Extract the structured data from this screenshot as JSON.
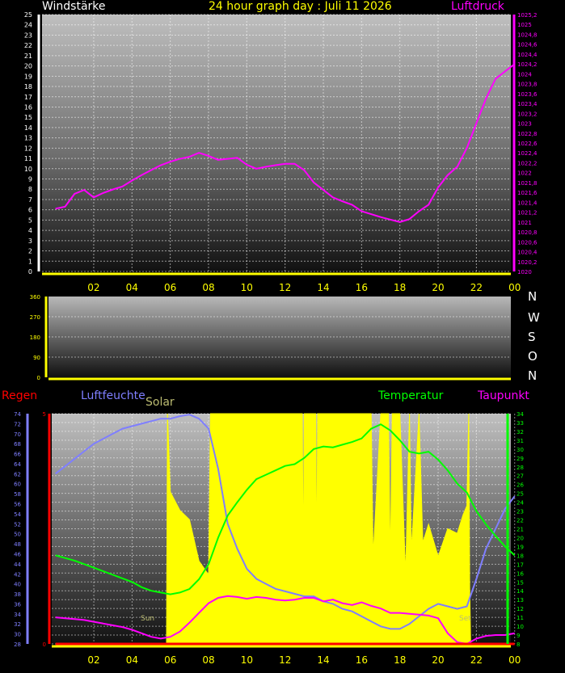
{
  "header": {
    "left_title": "Windstärke",
    "center_title": "24 hour graph day : Juli 11 2026",
    "right_title": "Luftdruck"
  },
  "colors": {
    "wind_axis": "#ffffff",
    "pressure": "#ff00ff",
    "time_axis": "#ffff00",
    "humidity": "#7f7fff",
    "temperature": "#00ff00",
    "dewpoint": "#ff00ff",
    "solar": "#ffff00",
    "rain": "#ff0000"
  },
  "compass": [
    "N",
    "W",
    "S",
    "O",
    "N"
  ],
  "legend2": {
    "rain": "Regen",
    "humidity": "Luftfeuchte",
    "solar": "Solar",
    "temperature": "Temperatur",
    "dewpoint": "Taupunkt"
  },
  "annotations": {
    "sunrise": "Sun",
    "sunset": "Set"
  },
  "chart_data": [
    {
      "type": "line",
      "title": "24 hour graph day : Juli 11 2026",
      "x_tick_labels": [
        "02",
        "04",
        "06",
        "08",
        "10",
        "12",
        "14",
        "16",
        "18",
        "20",
        "22",
        "00"
      ],
      "left_axis": {
        "label": "Windstärke",
        "range": [
          0,
          25
        ],
        "ticks": [
          0,
          1,
          2,
          3,
          4,
          5,
          6,
          7,
          8,
          9,
          10,
          11,
          12,
          13,
          14,
          15,
          16,
          17,
          18,
          19,
          20,
          21,
          22,
          23,
          24,
          25
        ]
      },
      "right_axis": {
        "label": "Luftdruck",
        "range": [
          1020,
          1025.2
        ],
        "ticks": [
          "1020",
          "1020,2",
          "1020,4",
          "1020,6",
          "1020,8",
          "1021",
          "1021,2",
          "1021,4",
          "1021,6",
          "1021,8",
          "1022",
          "1022,2",
          "1022,4",
          "1022,6",
          "1022,8",
          "1023",
          "1023,2",
          "1023,4",
          "1023,6",
          "1023,8",
          "1024",
          "1024,2",
          "1024,4",
          "1024,6",
          "1024,8",
          "1025",
          "1025,2"
        ]
      },
      "grid": true,
      "series": [
        {
          "name": "Luftdruck",
          "axis": "right",
          "x": [
            0.0,
            0.5,
            1.0,
            1.5,
            2.0,
            2.5,
            3.0,
            3.5,
            4.0,
            4.5,
            5.0,
            5.5,
            6.0,
            6.5,
            7.0,
            7.5,
            8.0,
            8.5,
            9.0,
            9.5,
            10.0,
            10.5,
            11.0,
            11.5,
            12.0,
            12.5,
            13.0,
            13.5,
            14.0,
            14.5,
            15.0,
            15.5,
            16.0,
            16.5,
            17.0,
            17.5,
            18.0,
            18.5,
            19.0,
            19.5,
            20.0,
            20.5,
            21.0,
            21.5,
            22.0,
            22.5,
            23.0,
            23.5,
            24.0
          ],
          "y": [
            1021.27,
            1021.31,
            1021.57,
            1021.65,
            1021.5,
            1021.59,
            1021.66,
            1021.72,
            1021.84,
            1021.95,
            1022.05,
            1022.15,
            1022.22,
            1022.28,
            1022.32,
            1022.4,
            1022.34,
            1022.26,
            1022.28,
            1022.3,
            1022.16,
            1022.08,
            1022.12,
            1022.15,
            1022.18,
            1022.18,
            1022.05,
            1021.8,
            1021.65,
            1021.5,
            1021.42,
            1021.35,
            1021.22,
            1021.16,
            1021.1,
            1021.05,
            1021.0,
            1021.06,
            1021.22,
            1021.35,
            1021.7,
            1021.95,
            1022.12,
            1022.5,
            1023.0,
            1023.5,
            1023.9,
            1024.05,
            1024.2
          ]
        }
      ]
    },
    {
      "type": "area",
      "left_axis": {
        "range": [
          0,
          360
        ],
        "ticks": [
          0,
          90,
          180,
          270,
          360
        ]
      },
      "compass_labels": [
        "N",
        "W",
        "S",
        "O",
        "N"
      ],
      "series": []
    },
    {
      "type": "line",
      "x_tick_labels": [
        "02",
        "04",
        "06",
        "08",
        "10",
        "12",
        "14",
        "16",
        "18",
        "20",
        "22",
        "00"
      ],
      "humidity_axis": {
        "label": "Luftfeuchte",
        "range": [
          28,
          74
        ],
        "ticks": [
          28,
          30,
          32,
          34,
          36,
          38,
          40,
          42,
          44,
          46,
          48,
          50,
          52,
          54,
          56,
          58,
          60,
          62,
          64,
          66,
          68,
          70,
          72,
          74
        ]
      },
      "rain_axis": {
        "label": "Regen",
        "range": [
          0,
          5
        ],
        "ticks": [
          0,
          5
        ]
      },
      "temperature_axis": {
        "label": "Temperatur",
        "range": [
          8,
          34
        ],
        "ticks": [
          8,
          9,
          10,
          11,
          12,
          13,
          14,
          15,
          16,
          17,
          18,
          19,
          20,
          21,
          22,
          23,
          24,
          25,
          26,
          27,
          28,
          29,
          30,
          31,
          32,
          33,
          34
        ]
      },
      "grid": true,
      "series": [
        {
          "name": "Luftfeuchte",
          "axis": "humidity",
          "x": [
            0.0,
            0.5,
            1.0,
            1.5,
            2.0,
            2.5,
            3.0,
            3.5,
            4.0,
            4.5,
            5.0,
            5.5,
            6.0,
            6.5,
            7.0,
            7.5,
            8.0,
            8.5,
            9.0,
            9.5,
            10.0,
            10.5,
            11.0,
            11.5,
            12.0,
            12.5,
            13.0,
            13.5,
            14.0,
            14.5,
            15.0,
            15.5,
            16.0,
            16.5,
            17.0,
            17.5,
            18.0,
            18.5,
            19.0,
            19.5,
            20.0,
            20.5,
            21.0,
            21.5,
            22.0,
            22.5,
            23.0,
            23.5,
            24.0
          ],
          "y": [
            62.0,
            63.5,
            65.0,
            66.5,
            68.0,
            69.0,
            70.0,
            71.0,
            71.5,
            72.0,
            72.5,
            73.0,
            73.0,
            73.5,
            73.8,
            73.0,
            71.0,
            63.0,
            52.0,
            47.0,
            43.0,
            41.0,
            40.0,
            39.0,
            38.5,
            38.0,
            37.5,
            37.5,
            36.5,
            36.0,
            35.0,
            34.5,
            33.5,
            32.5,
            31.5,
            31.0,
            31.0,
            32.0,
            33.5,
            35.0,
            36.0,
            35.5,
            35.0,
            35.5,
            41.0,
            47.0,
            51.0,
            55.0,
            57.5
          ]
        },
        {
          "name": "Temperatur",
          "axis": "temperature",
          "x": [
            0.0,
            0.5,
            1.0,
            1.5,
            2.0,
            2.5,
            3.0,
            3.5,
            4.0,
            4.5,
            5.0,
            5.5,
            6.0,
            6.5,
            7.0,
            7.5,
            8.0,
            8.5,
            9.0,
            9.5,
            10.0,
            10.5,
            11.0,
            11.5,
            12.0,
            12.5,
            13.0,
            13.5,
            14.0,
            14.5,
            15.0,
            15.5,
            16.0,
            16.5,
            17.0,
            17.5,
            18.0,
            18.5,
            19.0,
            19.5,
            20.0,
            20.5,
            21.0,
            21.5,
            22.0,
            22.5,
            23.0,
            23.5,
            24.0
          ],
          "y": [
            18.0,
            17.7,
            17.4,
            17.0,
            16.6,
            16.2,
            15.8,
            15.4,
            15.0,
            14.4,
            14.0,
            13.8,
            13.6,
            13.8,
            14.2,
            15.3,
            17.0,
            20.0,
            22.5,
            24.0,
            25.4,
            26.6,
            27.1,
            27.6,
            28.1,
            28.3,
            29.0,
            30.0,
            30.3,
            30.2,
            30.5,
            30.8,
            31.2,
            32.3,
            32.8,
            32.1,
            31.0,
            29.7,
            29.5,
            29.7,
            28.8,
            27.6,
            26.1,
            25.1,
            23.0,
            21.5,
            20.2,
            19.0,
            18.0
          ]
        },
        {
          "name": "Taupunkt",
          "axis": "temperature",
          "x": [
            0.0,
            0.5,
            1.0,
            1.5,
            2.0,
            2.5,
            3.0,
            3.5,
            4.0,
            4.5,
            5.0,
            5.5,
            6.0,
            6.5,
            7.0,
            7.5,
            8.0,
            8.5,
            9.0,
            9.5,
            10.0,
            10.5,
            11.0,
            11.5,
            12.0,
            12.5,
            13.0,
            13.5,
            14.0,
            14.5,
            15.0,
            15.5,
            16.0,
            16.5,
            17.0,
            17.5,
            18.0,
            18.5,
            19.0,
            19.5,
            20.0,
            20.5,
            21.0,
            21.5,
            22.0,
            22.5,
            23.0,
            23.5,
            24.0
          ],
          "y": [
            11.0,
            10.9,
            10.8,
            10.7,
            10.5,
            10.3,
            10.1,
            9.9,
            9.6,
            9.2,
            8.8,
            8.6,
            8.8,
            9.4,
            10.4,
            11.5,
            12.6,
            13.2,
            13.4,
            13.3,
            13.1,
            13.3,
            13.2,
            13.0,
            12.9,
            13.0,
            13.2,
            13.2,
            12.8,
            13.0,
            12.6,
            12.4,
            12.7,
            12.3,
            12.0,
            11.5,
            11.5,
            11.4,
            11.3,
            11.2,
            10.9,
            9.2,
            8.2,
            8.0,
            8.6,
            8.9,
            9.0,
            9.0,
            9.2
          ]
        },
        {
          "name": "Solar",
          "axis": "rain",
          "fill": true,
          "x": [
            0.0,
            5.8,
            5.85,
            6.0,
            6.5,
            7.0,
            7.5,
            8.0,
            8.1,
            8.2,
            9.0,
            10.0,
            11.0,
            12.0,
            12.9,
            12.95,
            13.0,
            13.6,
            13.65,
            13.7,
            14.0,
            15.0,
            16.0,
            16.5,
            16.6,
            17.0,
            17.4,
            17.5,
            17.6,
            18.0,
            18.3,
            18.5,
            18.6,
            19.0,
            19.2,
            19.5,
            20.0,
            20.5,
            21.0,
            21.3,
            21.5,
            21.6,
            21.65,
            21.7,
            24.0
          ],
          "y": [
            0.0,
            0.0,
            5.0,
            3.3,
            2.9,
            2.7,
            1.8,
            1.5,
            5.0,
            5.0,
            5.0,
            5.0,
            5.0,
            5.0,
            5.0,
            1.6,
            5.0,
            5.0,
            1.7,
            5.0,
            5.0,
            5.0,
            5.0,
            5.0,
            1.9,
            5.0,
            5.0,
            1.8,
            5.0,
            5.0,
            1.5,
            5.0,
            2.0,
            5.0,
            2.2,
            2.6,
            1.9,
            2.5,
            2.4,
            2.8,
            3.0,
            5.0,
            1.2,
            0.0,
            0.0
          ]
        },
        {
          "name": "Regen",
          "axis": "rain",
          "x": [
            0.0,
            24.0
          ],
          "y": [
            0.0,
            0.0
          ]
        }
      ]
    }
  ]
}
